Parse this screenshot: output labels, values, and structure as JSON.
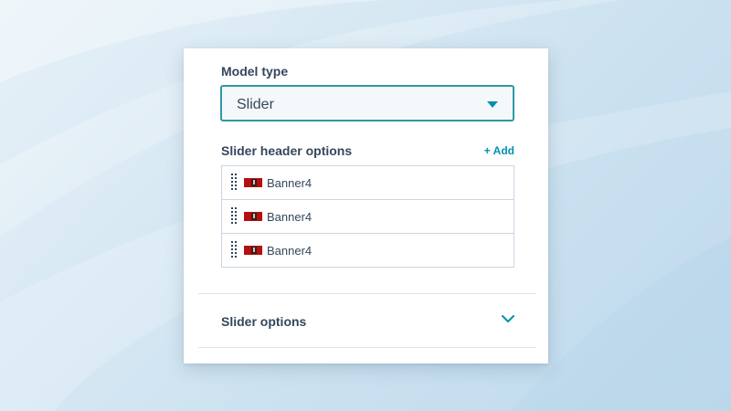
{
  "model_type": {
    "label": "Model type",
    "selected": "Slider"
  },
  "slider_header_options": {
    "label": "Slider header options",
    "add_label": "+ Add",
    "items": [
      {
        "label": "Banner4",
        "icon": "banner-thumbnail-icon"
      },
      {
        "label": "Banner4",
        "icon": "banner-thumbnail-icon"
      },
      {
        "label": "Banner4",
        "icon": "banner-thumbnail-icon"
      }
    ]
  },
  "slider_options": {
    "label": "Slider options",
    "icon": "chevron-down-icon"
  },
  "colors": {
    "text": "#33475b",
    "accent": "#0091ae",
    "select_border": "#2d99a6",
    "border": "#cbd6e2"
  }
}
